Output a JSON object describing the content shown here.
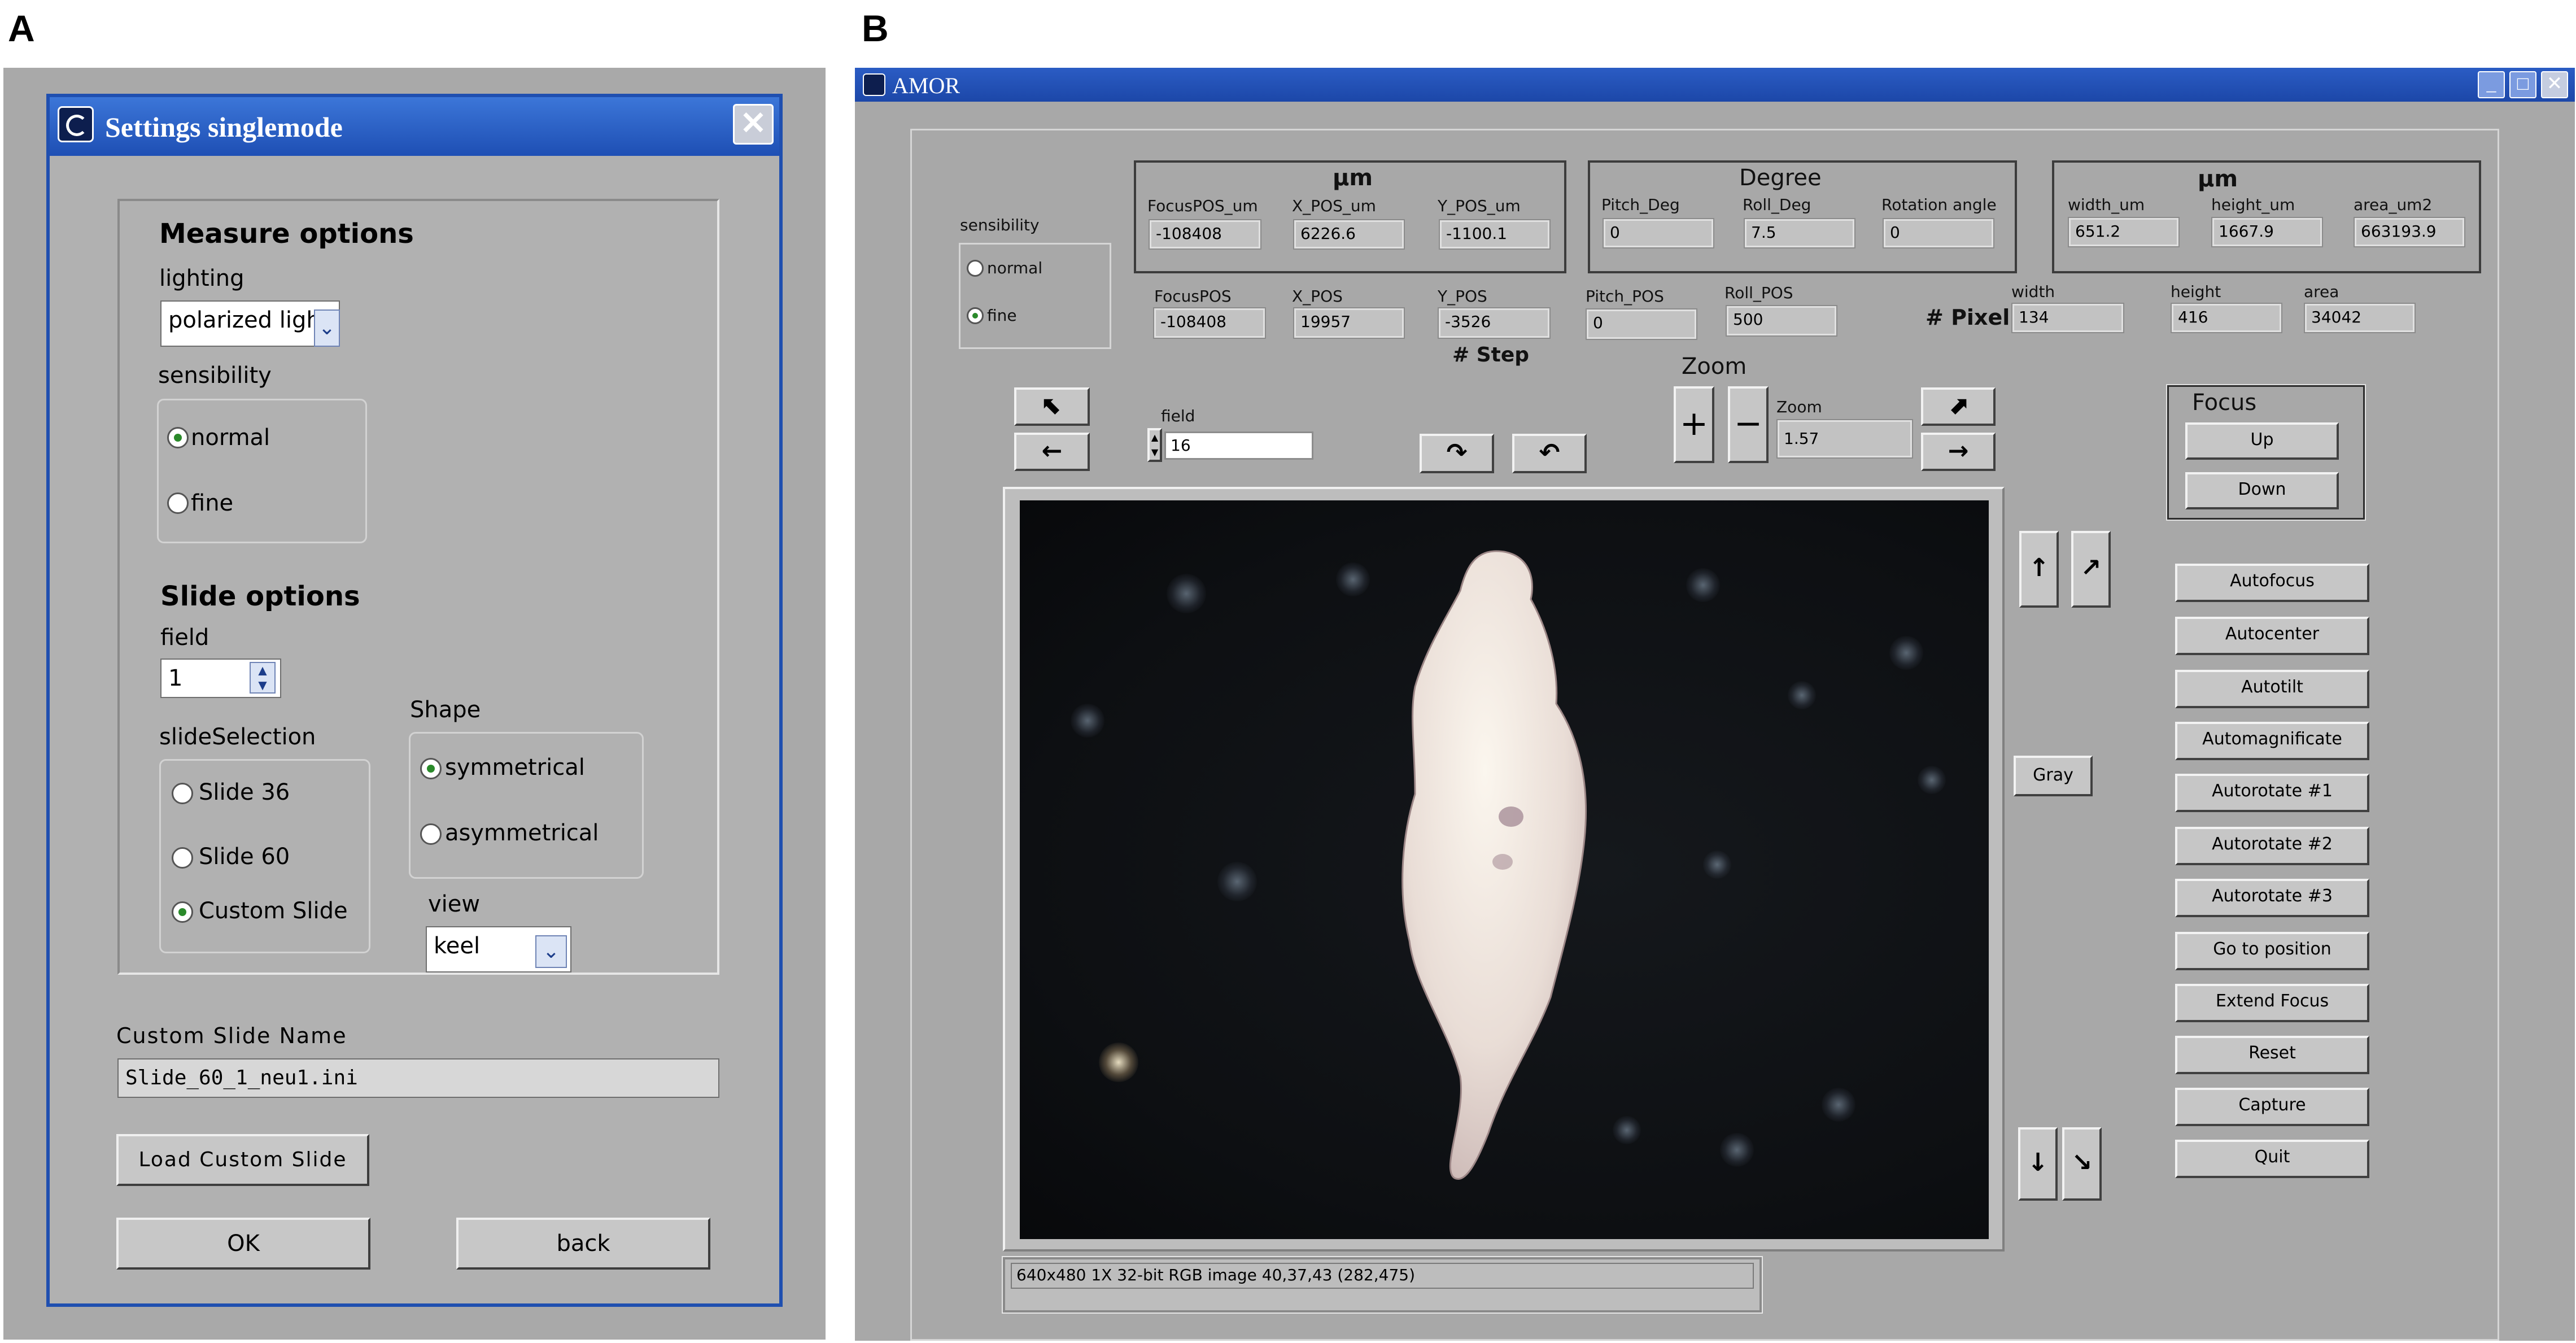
{
  "panel_labels": {
    "a": "A",
    "b": "B"
  },
  "settings_dialog": {
    "title": "Settings singlemode",
    "measure_options": {
      "header": "Measure options",
      "lighting_label": "lighting",
      "lighting_value": "polarized light",
      "sensibility_label": "sensibility",
      "sensibility_options": [
        "normal",
        "fine"
      ],
      "sensibility_selected": "normal"
    },
    "slide_options": {
      "header": "Slide options",
      "field_label": "field",
      "field_value": "1",
      "slide_selection_label": "slideSelection",
      "slide_selection_options": [
        "Slide 36",
        "Slide 60",
        "Custom Slide"
      ],
      "slide_selection_selected": "Custom Slide",
      "shape_label": "Shape",
      "shape_options": [
        "symmetrical",
        "asymmetrical"
      ],
      "shape_selected": "symmetrical",
      "view_label": "view",
      "view_value": "keel"
    },
    "custom_slide_name_label": "Custom Slide Name",
    "custom_slide_name_value": "Slide_60_1_neu1.ini",
    "load_button": "Load Custom Slide",
    "ok_button": "OK",
    "back_button": "back"
  },
  "amor_window": {
    "title": "AMOR",
    "sensibility": {
      "label": "sensibility",
      "options": [
        "normal",
        "fine"
      ],
      "selected": "fine"
    },
    "um_group": {
      "header": "µm",
      "labels": [
        "FocusPOS_um",
        "X_POS_um",
        "Y_POS_um"
      ],
      "values": [
        "-108408",
        "6226.6",
        "-1100.1"
      ]
    },
    "degree_group": {
      "header": "Degree",
      "labels": [
        "Pitch_Deg",
        "Roll_Deg",
        "Rotation angle"
      ],
      "values": [
        "0",
        "7.5",
        "0"
      ]
    },
    "dim_group": {
      "header": "µm",
      "labels": [
        "width_um",
        "height_um",
        "area_um2"
      ],
      "values": [
        "651.2",
        "1667.9",
        "663193.9"
      ]
    },
    "step_row": {
      "labels": [
        "FocusPOS",
        "X_POS",
        "Y_POS",
        "Pitch_POS",
        "Roll_POS"
      ],
      "values": [
        "-108408",
        "19957",
        "-3526",
        "0",
        "500"
      ],
      "caption": "# Step"
    },
    "pixel_row": {
      "caption": "# Pixel",
      "labels": [
        "width",
        "height",
        "area"
      ],
      "values": [
        "134",
        "416",
        "34042"
      ]
    },
    "field": {
      "label": "field",
      "value": "16"
    },
    "zoom": {
      "header": "Zoom",
      "label": "Zoom",
      "value": "1.57",
      "plus": "+",
      "minus": "−"
    },
    "focus": {
      "header": "Focus",
      "up": "Up",
      "down": "Down"
    },
    "gray_button": "Gray",
    "action_buttons": [
      "Autofocus",
      "Autocenter",
      "Autotilt",
      "Automagnificate",
      "Autorotate #1",
      "Autorotate #2",
      "Autorotate #3",
      "Go to position",
      "Extend Focus",
      "Reset",
      "Capture",
      "Quit"
    ],
    "arrows": {
      "up_left": "⬉",
      "left": "←",
      "rot_cw": "↷",
      "rot_ccw": "↶",
      "up_right": "⬈",
      "right": "→",
      "up": "↑",
      "tilt": "↗",
      "down": "↓",
      "down_right": "↘"
    },
    "status_text": "640x480 1X 32-bit RGB image 40,37,43    (282,475)"
  }
}
